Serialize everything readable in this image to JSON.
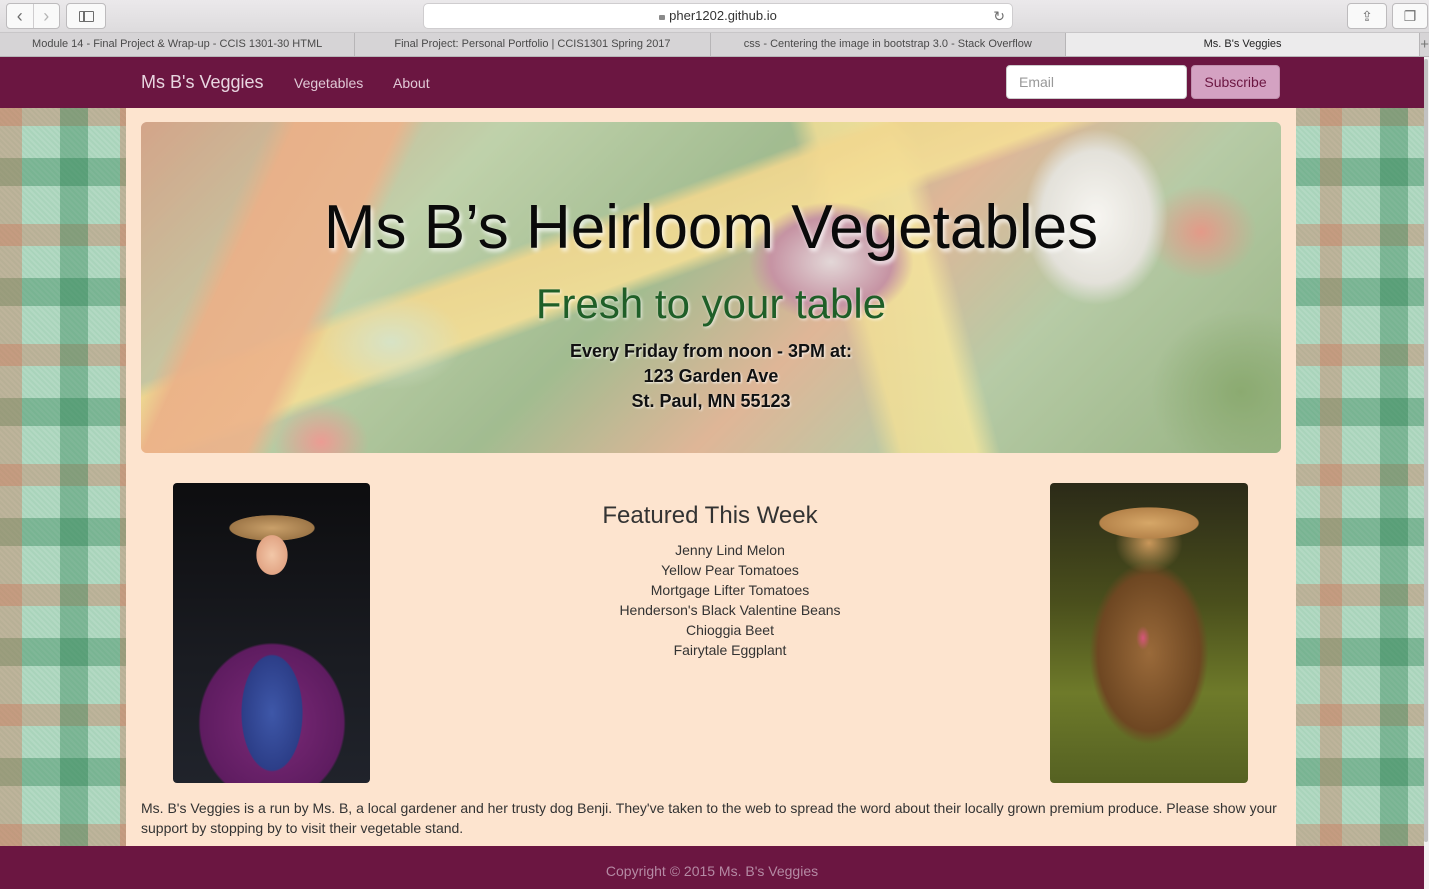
{
  "browser": {
    "url": "pher1202.github.io",
    "tabs": [
      {
        "label": "Module 14 - Final Project & Wrap-up - CCIS 1301-30 HTML"
      },
      {
        "label": "Final Project: Personal Portfolio | CCIS1301 Spring 2017"
      },
      {
        "label": "css - Centering the image in bootstrap 3.0 - Stack Overflow"
      },
      {
        "label": "Ms. B's Veggies"
      }
    ],
    "new_tab": "+"
  },
  "nav": {
    "brand": "Ms B's Veggies",
    "links": [
      "Vegetables",
      "About"
    ],
    "email_placeholder": "Email",
    "subscribe_label": "Subscribe"
  },
  "hero": {
    "title": "Ms B’s Heirloom Vegetables",
    "subtitle": "Fresh to your table",
    "lines": [
      "Every Friday from noon - 3PM at:",
      "123 Garden Ave",
      "St. Paul, MN 55123"
    ]
  },
  "featured": {
    "title": "Featured This Week",
    "items": [
      "Jenny Lind Melon",
      "Yellow Pear Tomatoes",
      "Mortgage Lifter Tomatoes",
      "Henderson's Black Valentine Beans",
      "Chioggia Beet",
      "Fairytale Eggplant"
    ]
  },
  "about": {
    "text": "Ms. B's Veggies is a run by Ms. B, a local gardener and her trusty dog Benji. They've taken to the web to spread the word about their locally grown premium produce. Please show your support by stopping by to visit their vegetable stand."
  },
  "footer": {
    "copyright": "Copyright © 2015 Ms. B's Veggies"
  },
  "colors": {
    "brand": "#6b1641",
    "content_bg": "#fde4cf",
    "subscribe_bg": "#d4a2c2",
    "subtitle": "#1f5f28"
  }
}
